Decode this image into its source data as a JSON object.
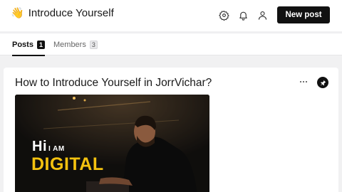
{
  "header": {
    "emoji": "👋",
    "title": "Introduce Yourself",
    "new_post_label": "New post",
    "icons": [
      "settings-icon",
      "bell-icon",
      "user-icon"
    ]
  },
  "tabs": [
    {
      "label": "Posts",
      "count": "1",
      "active": true
    },
    {
      "label": "Members",
      "count": "3",
      "active": false
    }
  ],
  "post": {
    "title": "How to Introduce Yourself in JorrVichar?",
    "thumbnail": {
      "line1_big": "Hi",
      "line1_small": "I AM",
      "line2": "DIGITAL"
    }
  },
  "colors": {
    "accent": "#111111",
    "thumbnail_text_yellow": "#f4c20f",
    "background": "#f1f1f2"
  }
}
